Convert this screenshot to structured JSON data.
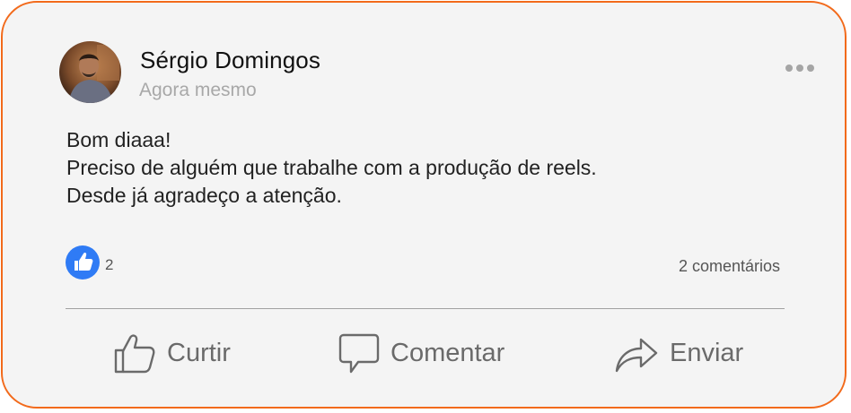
{
  "post": {
    "author": "Sérgio Domingos",
    "time": "Agora mesmo",
    "lines": [
      "Bom diaaa!",
      "Preciso de alguém que trabalhe com a produção de reels.",
      "Desde já agradeço a atenção."
    ],
    "likes": "2",
    "comments": "2 comentários"
  },
  "actions": {
    "like_label": "Curtir",
    "comment_label": "Comentar",
    "share_label": "Enviar"
  },
  "colors": {
    "border": "#f26a1b",
    "card_bg": "#f4f4f4",
    "like_blue": "#2f7bf5",
    "muted": "#6a6a6a"
  },
  "icons": {
    "avatar": "profile-photo",
    "more": "ellipsis-icon",
    "like_badge": "thumbs-up-icon",
    "like": "thumbs-up-outline-icon",
    "comment": "speech-bubble-icon",
    "share": "share-arrow-icon"
  }
}
